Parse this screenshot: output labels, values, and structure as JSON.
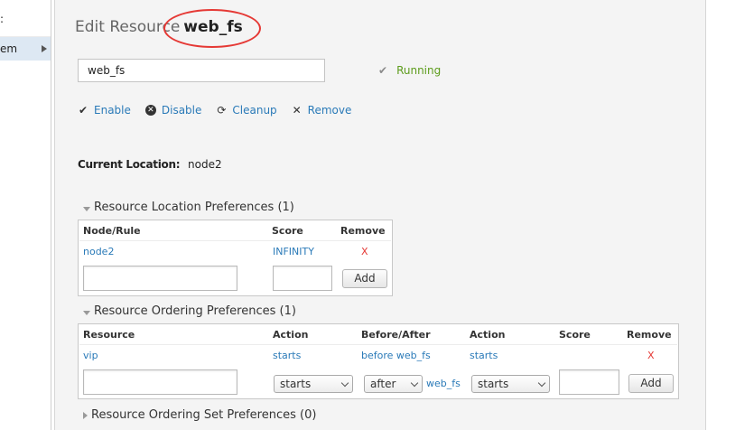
{
  "sidebar": {
    "top_fragment": ":",
    "item_fragment": "em"
  },
  "header": {
    "prefix": "Edit Resource",
    "resource_name": "web_fs"
  },
  "name_input": {
    "value": "web_fs"
  },
  "status": {
    "text": "Running"
  },
  "actions": {
    "enable": "Enable",
    "disable": "Disable",
    "cleanup": "Cleanup",
    "remove": "Remove"
  },
  "current_location": {
    "label": "Current Location:",
    "value": "node2"
  },
  "location_prefs": {
    "title": "Resource Location Preferences (1)",
    "headers": {
      "node": "Node/Rule",
      "score": "Score",
      "remove": "Remove"
    },
    "row": {
      "node": "node2",
      "score": "INFINITY",
      "remove": "X"
    },
    "add_button": "Add"
  },
  "ordering_prefs": {
    "title": "Resource Ordering Preferences (1)",
    "headers": {
      "resource": "Resource",
      "action": "Action",
      "before_after": "Before/After",
      "action2": "Action",
      "score": "Score",
      "remove": "Remove"
    },
    "row": {
      "resource": "vip",
      "action": "starts",
      "before_after": "before web_fs",
      "action2": "starts",
      "remove": "X"
    },
    "new_row": {
      "action_select": "starts",
      "order_select": "after",
      "resource_link": "web_fs",
      "action2_select": "starts"
    },
    "add_button": "Add"
  },
  "ordering_set_prefs": {
    "title": "Resource Ordering Set Preferences (0)"
  },
  "colors": {
    "link": "#2a7ab8",
    "running": "#5d9c1c",
    "remove": "#e53935",
    "annotation": "#e53935"
  }
}
